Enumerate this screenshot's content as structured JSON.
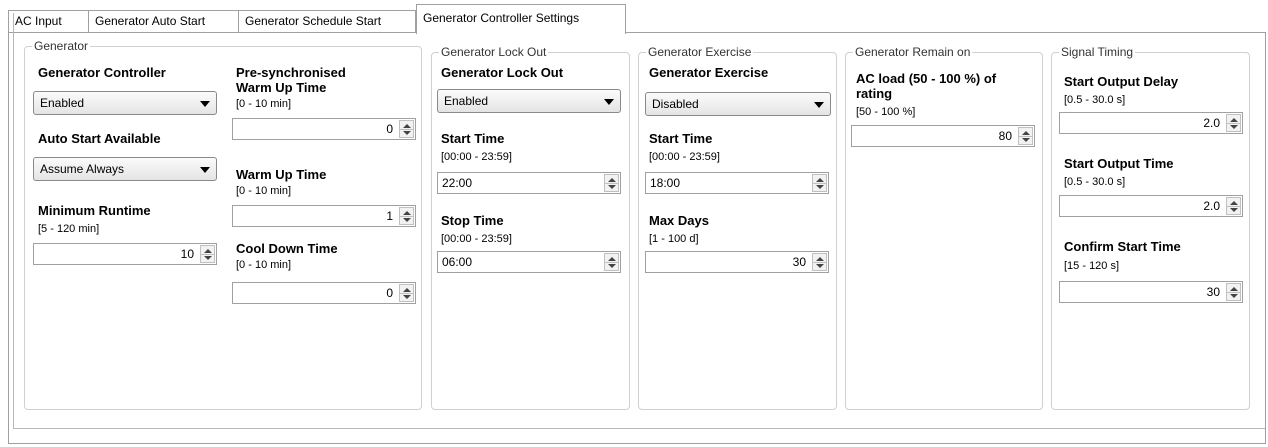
{
  "tabs": [
    "AC Input",
    "Generator Auto Start",
    "Generator Schedule Start",
    "Generator Controller Settings"
  ],
  "generator": {
    "title": "Generator",
    "controller_label": "Generator Controller",
    "controller_value": "Enabled",
    "auto_start_label": "Auto Start Available",
    "auto_start_value": "Assume Always",
    "min_runtime_label": "Minimum Runtime",
    "min_runtime_range": "[5 - 120 min]",
    "min_runtime_value": "10",
    "presync_label_1": "Pre-synchronised",
    "presync_label_2": "Warm Up Time",
    "presync_range": "[0 - 10 min]",
    "presync_value": "0",
    "warmup_label": "Warm Up Time",
    "warmup_range": "[0 - 10 min]",
    "warmup_value": "1",
    "cooldown_label": "Cool Down Time",
    "cooldown_range": "[0 - 10 min]",
    "cooldown_value": "0"
  },
  "lockout": {
    "title": "Generator Lock Out",
    "label": "Generator Lock Out",
    "value": "Enabled",
    "start_label": "Start Time",
    "start_range": "[00:00 - 23:59]",
    "start_value": "22:00",
    "stop_label": "Stop Time",
    "stop_range": "[00:00 - 23:59]",
    "stop_value": "06:00"
  },
  "exercise": {
    "title": "Generator Exercise",
    "label": "Generator Exercise",
    "value": "Disabled",
    "start_label": "Start Time",
    "start_range": "[00:00 - 23:59]",
    "start_value": "18:00",
    "maxdays_label": "Max Days",
    "maxdays_range": "[1 - 100 d]",
    "maxdays_value": "30"
  },
  "remain": {
    "title": "Generator Remain on",
    "label_1": "AC load (50 - 100 %) of",
    "label_2": "rating",
    "range": "[50 - 100 %]",
    "value": "80"
  },
  "timing": {
    "title": "Signal Timing",
    "delay_label": "Start Output Delay",
    "delay_range": "[0.5 - 30.0 s]",
    "delay_value": "2.0",
    "time_label": "Start Output Time",
    "time_range": "[0.5 - 30.0 s]",
    "time_value": "2.0",
    "confirm_label": "Confirm Start Time",
    "confirm_range": "[15 - 120 s]",
    "confirm_value": "30"
  }
}
